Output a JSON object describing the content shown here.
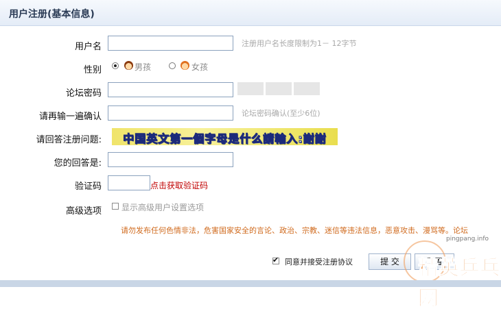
{
  "header": {
    "title": "用户注册(基本信息)"
  },
  "fields": {
    "username": {
      "label": "用户名",
      "value": "",
      "hint": "注册用户名长度限制为1－ 12字节"
    },
    "gender": {
      "label": "性别",
      "options": [
        {
          "label": "男孩",
          "selected": true,
          "icon": "boy-face-icon"
        },
        {
          "label": "女孩",
          "selected": false,
          "icon": "girl-face-icon"
        }
      ]
    },
    "password": {
      "label": "论坛密码",
      "value": ""
    },
    "confirm": {
      "label": "请再输一遍确认",
      "value": "",
      "hint": "论坛密码确认(至少6位)"
    },
    "question": {
      "label": "请回答注册问题:",
      "image_text": "中国英文第一個字母是什么請輸入:謝謝"
    },
    "answer": {
      "label": "您的回答是:",
      "value": ""
    },
    "captcha": {
      "label": "验证码",
      "value": "",
      "link": "点击获取验证码"
    },
    "advanced": {
      "label": "高级选项",
      "option": "显示高级用户设置选项",
      "checked": false
    }
  },
  "notice": "请勿发布任何色情非法，危害国家安全的言论、政治、宗教、迷信等违法信息，恶意攻击、漫骂等。论坛",
  "footer": {
    "agree_label": "同意并接受注册协议",
    "agree_checked": true,
    "submit_label": "提  交",
    "reset_label": "重置"
  },
  "watermark": {
    "url": "pingpang.info",
    "text": "精英乒乓网"
  },
  "colors": {
    "header_bg": "#e4ecf7",
    "border": "#8aa1bd",
    "link": "#c00000",
    "notice": "#d06a1d",
    "hint": "#a8a8a8"
  }
}
